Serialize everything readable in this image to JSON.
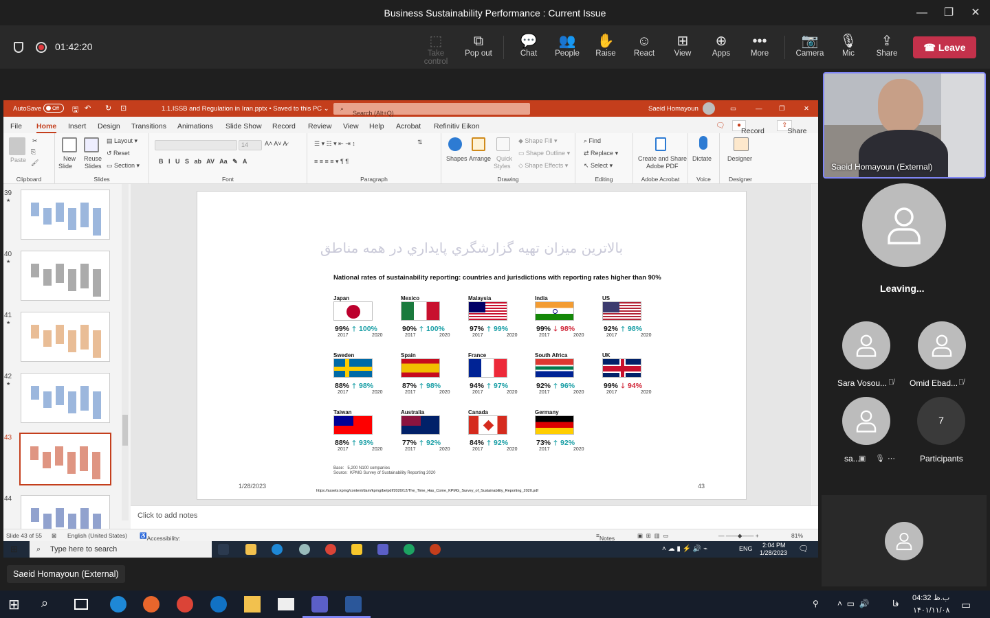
{
  "window": {
    "title": "Business Sustainability Performance : Current Issue",
    "minimize": "—",
    "maximize": "❐",
    "close": "✕"
  },
  "meeting": {
    "timer": "01:42:20",
    "toolbar": [
      {
        "label": "Take control",
        "icon": "⬚",
        "disabled": true
      },
      {
        "label": "Pop out",
        "icon": "⧉"
      },
      {
        "label": "Chat",
        "icon": "💬"
      },
      {
        "label": "People",
        "icon": "👥"
      },
      {
        "label": "Raise",
        "icon": "✋"
      },
      {
        "label": "React",
        "icon": "☺"
      },
      {
        "label": "View",
        "icon": "⊞"
      },
      {
        "label": "Apps",
        "icon": "⊕"
      },
      {
        "label": "More",
        "icon": "•••"
      },
      {
        "label": "Camera",
        "icon": "📷"
      },
      {
        "label": "Mic",
        "icon": "🎙"
      },
      {
        "label": "Share",
        "icon": "⇪"
      }
    ],
    "leave_label": "Leave",
    "sharer_label": "Saeid Homayoun (External)"
  },
  "ppt": {
    "autosave": "AutoSave",
    "autosave_state": "Off",
    "filename": "1.1.ISSB and Regulation in Iran.pptx • Saved to this PC ⌄",
    "search_placeholder": "Search (Alt+Q)",
    "user": "Saeid Homayoun",
    "menu": [
      "File",
      "Home",
      "Insert",
      "Design",
      "Transitions",
      "Animations",
      "Slide Show",
      "Record",
      "Review",
      "View",
      "Help",
      "Acrobat",
      "Refinitiv Eikon"
    ],
    "record_btn": "Record",
    "share_btn": "Share",
    "ribbon": {
      "clipboard": {
        "label": "Clipboard",
        "paste": "Paste"
      },
      "slides": {
        "label": "Slides",
        "new": "New",
        "slide": "Slide",
        "reuse": "Reuse",
        "slides": "Slides",
        "layout": "Layout",
        "reset": "Reset",
        "section": "Section"
      },
      "font": {
        "label": "Font",
        "size": "14"
      },
      "paragraph": {
        "label": "Paragraph"
      },
      "drawing": {
        "label": "Drawing",
        "shapes": "Shapes",
        "arrange": "Arrange",
        "quick": "Quick",
        "styles": "Styles",
        "fill": "Shape Fill",
        "outline": "Shape Outline",
        "effects": "Shape Effects"
      },
      "editing": {
        "label": "Editing",
        "find": "Find",
        "replace": "Replace",
        "select": "Select"
      },
      "acrobat": {
        "label": "Adobe Acrobat",
        "create": "Create and Share",
        "pdf": "Adobe PDF"
      },
      "voice": {
        "label": "Voice",
        "dictate": "Dictate"
      },
      "designer": {
        "label": "Designer",
        "designer": "Designer"
      }
    },
    "thumbs": [
      {
        "num": "39",
        "star": "★"
      },
      {
        "num": "40",
        "star": "★"
      },
      {
        "num": "41",
        "star": "★"
      },
      {
        "num": "42",
        "star": "★"
      },
      {
        "num": "43",
        "star": ""
      },
      {
        "num": "44",
        "star": ""
      }
    ],
    "notes_placeholder": "Click to add notes",
    "status": {
      "slide": "Slide 43 of 55",
      "lang": "English (United States)",
      "access": "Accessibility: Investigate",
      "notes": "Notes",
      "zoom": "81%"
    },
    "taskbar": {
      "search": "Type here to search",
      "time": "2:04 PM",
      "date": "1/28/2023",
      "lang": "ENG"
    }
  },
  "slide": {
    "title_fa": "بالاترين ميزان تهيه گزارشگري پايداري در همه مناطق",
    "subtitle": "National rates of sustainability reporting: countries and jurisdictions with reporting rates higher than 90%",
    "year_a": "2017",
    "year_b": "2020",
    "countries": [
      {
        "name": "Japan",
        "a": "99%",
        "b": "100%",
        "dir": "up"
      },
      {
        "name": "Mexico",
        "a": "90%",
        "b": "100%",
        "dir": "up"
      },
      {
        "name": "Malaysia",
        "a": "97%",
        "b": "99%",
        "dir": "up"
      },
      {
        "name": "India",
        "a": "99%",
        "b": "98%",
        "dir": "down"
      },
      {
        "name": "US",
        "a": "92%",
        "b": "98%",
        "dir": "up"
      },
      {
        "name": "Sweden",
        "a": "88%",
        "b": "98%",
        "dir": "up"
      },
      {
        "name": "Spain",
        "a": "87%",
        "b": "98%",
        "dir": "up"
      },
      {
        "name": "France",
        "a": "94%",
        "b": "97%",
        "dir": "up"
      },
      {
        "name": "South Africa",
        "a": "92%",
        "b": "96%",
        "dir": "up"
      },
      {
        "name": "UK",
        "a": "99%",
        "b": "94%",
        "dir": "down"
      },
      {
        "name": "Taiwan",
        "a": "88%",
        "b": "93%",
        "dir": "up"
      },
      {
        "name": "Australia",
        "a": "77%",
        "b": "92%",
        "dir": "up"
      },
      {
        "name": "Canada",
        "a": "84%",
        "b": "92%",
        "dir": "up"
      },
      {
        "name": "Germany",
        "a": "73%",
        "b": "92%",
        "dir": "up"
      }
    ],
    "base_label": "Base:",
    "base_value": "5,200 N100 companies",
    "source_label": "Source:",
    "source_value": "KPMG Survey of Sustainability Reporting 2020",
    "date": "1/28/2023",
    "number": "43",
    "url": "https://assets.kpmg/content/dam/kpmg/be/pdf/2020/12/The_Time_Has_Come_KPMG_Survey_of_Sustainability_Reporting_2020.pdf"
  },
  "participants": {
    "video_name": "Saeid Homayoun (External)",
    "leaving_label": "Leaving...",
    "tiles": [
      {
        "name": "Sara Vosou..."
      },
      {
        "name": "Omid Ebad..."
      },
      {
        "name": "sa..."
      }
    ],
    "count": "7",
    "count_label": "Participants"
  },
  "os": {
    "time": "04:32 ب.ظ",
    "date": "۱۴۰۱/۱۱/۰۸",
    "lang": "فا"
  }
}
